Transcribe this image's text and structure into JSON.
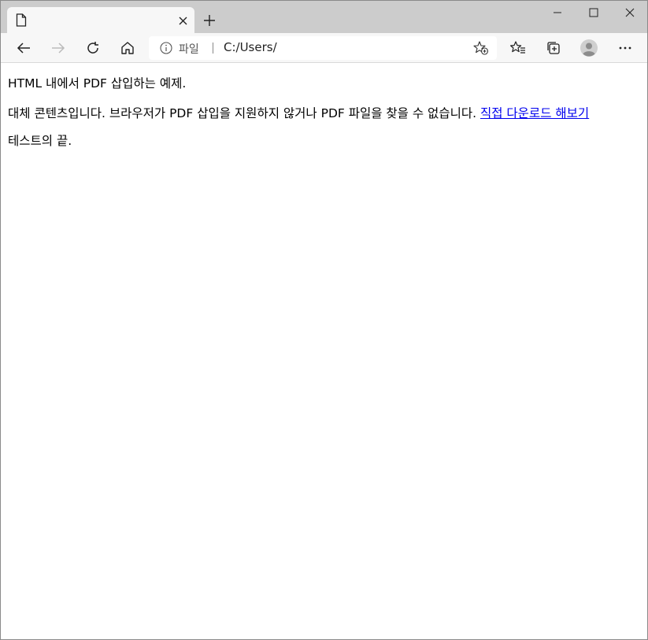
{
  "window": {
    "tab_title": "",
    "controls": {
      "minimize": "minimize-icon",
      "maximize": "maximize-icon",
      "close": "close-icon"
    }
  },
  "toolbar": {
    "address": {
      "scheme_label": "파일",
      "url": "C:/Users/"
    }
  },
  "content": {
    "paragraph1": "HTML 내에서 PDF 삽입하는 예제.",
    "paragraph2_text": "대체 콘텐츠입니다. 브라우저가 PDF 삽입을 지원하지 않거나 PDF 파일을 찾을 수 없습니다. ",
    "paragraph2_link": "직접 다운로드 해보기",
    "paragraph3": "테스트의 끝."
  }
}
